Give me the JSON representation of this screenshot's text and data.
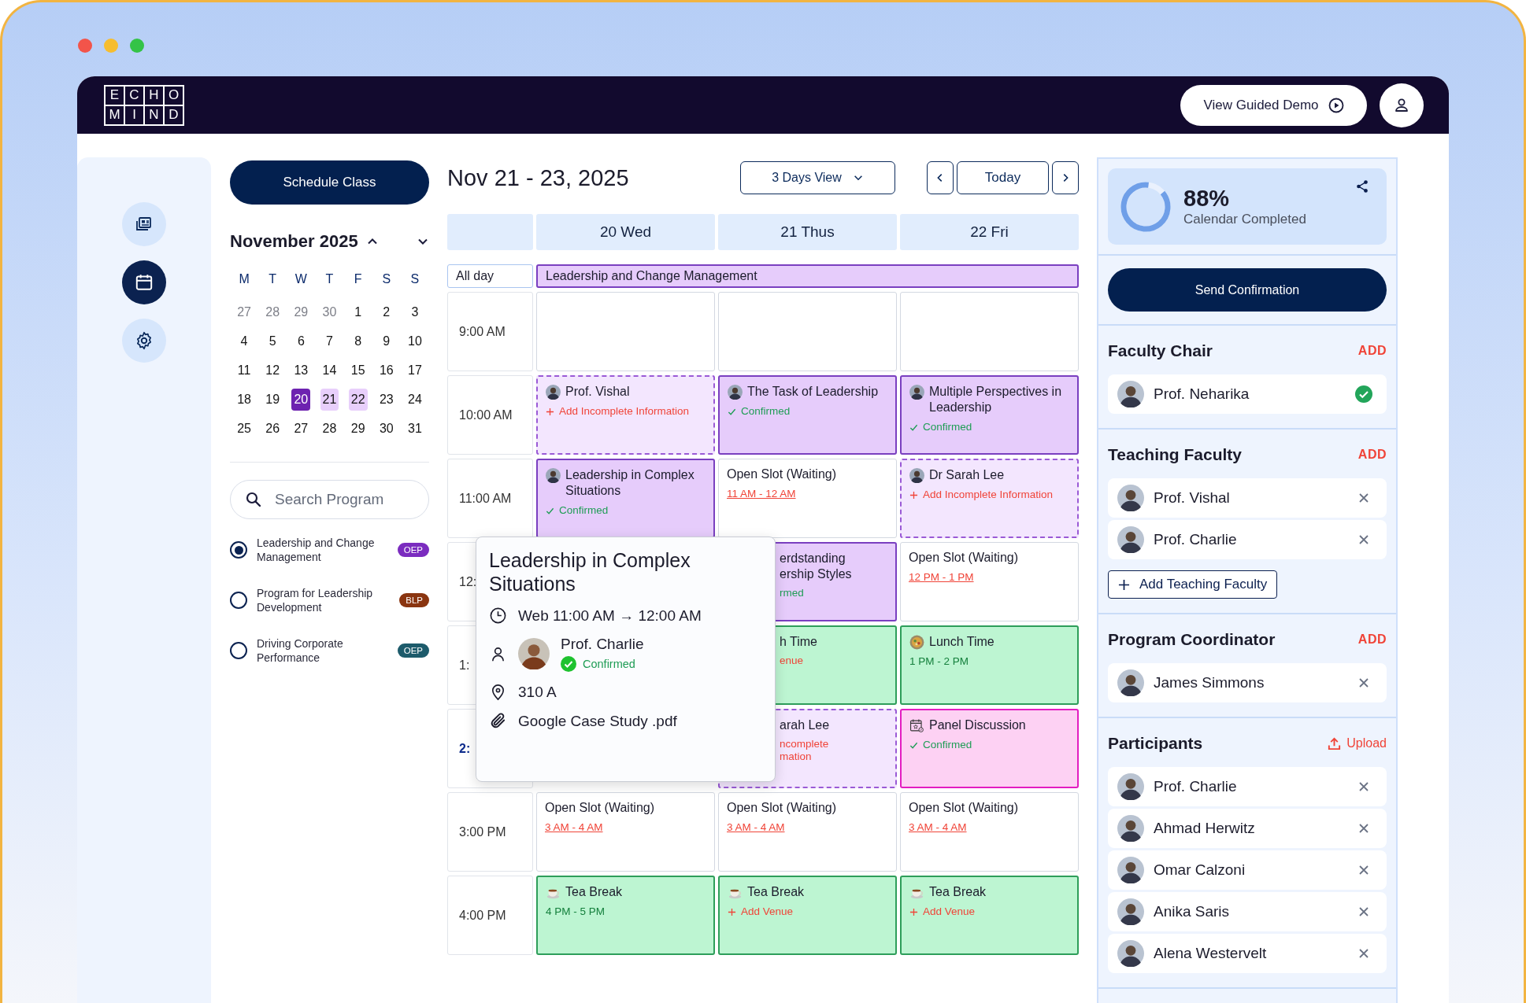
{
  "header": {
    "logo_rows": [
      [
        "E",
        "C",
        "H",
        "O"
      ],
      [
        "M",
        "I",
        "N",
        "D"
      ]
    ],
    "demo_button": "View Guided Demo"
  },
  "rail": [
    {
      "kind": "news",
      "selected": false
    },
    {
      "kind": "calendar",
      "selected": true
    },
    {
      "kind": "settings",
      "selected": false
    }
  ],
  "schedule_button": "Schedule Class",
  "mini_calendar": {
    "month": "November 2025",
    "weekdays": [
      "M",
      "T",
      "W",
      "T",
      "F",
      "S",
      "S"
    ],
    "weeks": [
      [
        {
          "label": "27",
          "muted": true,
          "selected": false,
          "range": false
        },
        {
          "label": "28",
          "muted": true,
          "selected": false,
          "range": false
        },
        {
          "label": "29",
          "muted": true,
          "selected": false,
          "range": false
        },
        {
          "label": "30",
          "muted": true,
          "selected": false,
          "range": false
        },
        {
          "label": "1",
          "muted": false,
          "selected": false,
          "range": false
        },
        {
          "label": "2",
          "muted": false,
          "selected": false,
          "range": false
        },
        {
          "label": "3",
          "muted": false,
          "selected": false,
          "range": false
        }
      ],
      [
        {
          "label": "4",
          "muted": false,
          "selected": false,
          "range": false
        },
        {
          "label": "5",
          "muted": false,
          "selected": false,
          "range": false
        },
        {
          "label": "6",
          "muted": false,
          "selected": false,
          "range": false
        },
        {
          "label": "7",
          "muted": false,
          "selected": false,
          "range": false
        },
        {
          "label": "8",
          "muted": false,
          "selected": false,
          "range": false
        },
        {
          "label": "9",
          "muted": false,
          "selected": false,
          "range": false
        },
        {
          "label": "10",
          "muted": false,
          "selected": false,
          "range": false
        }
      ],
      [
        {
          "label": "11",
          "muted": false,
          "selected": false,
          "range": false
        },
        {
          "label": "12",
          "muted": false,
          "selected": false,
          "range": false
        },
        {
          "label": "13",
          "muted": false,
          "selected": false,
          "range": false
        },
        {
          "label": "14",
          "muted": false,
          "selected": false,
          "range": false
        },
        {
          "label": "15",
          "muted": false,
          "selected": false,
          "range": false
        },
        {
          "label": "16",
          "muted": false,
          "selected": false,
          "range": false
        },
        {
          "label": "17",
          "muted": false,
          "selected": false,
          "range": false
        }
      ],
      [
        {
          "label": "18",
          "muted": false,
          "selected": false,
          "range": false
        },
        {
          "label": "19",
          "muted": false,
          "selected": false,
          "range": false
        },
        {
          "label": "20",
          "muted": false,
          "selected": true,
          "range": false
        },
        {
          "label": "21",
          "muted": false,
          "selected": false,
          "range": true
        },
        {
          "label": "22",
          "muted": false,
          "selected": false,
          "range": true
        },
        {
          "label": "23",
          "muted": false,
          "selected": false,
          "range": false
        },
        {
          "label": "24",
          "muted": false,
          "selected": false,
          "range": false
        }
      ],
      [
        {
          "label": "25",
          "muted": false,
          "selected": false,
          "range": false
        },
        {
          "label": "26",
          "muted": false,
          "selected": false,
          "range": false
        },
        {
          "label": "27",
          "muted": false,
          "selected": false,
          "range": false
        },
        {
          "label": "28",
          "muted": false,
          "selected": false,
          "range": false
        },
        {
          "label": "29",
          "muted": false,
          "selected": false,
          "range": false
        },
        {
          "label": "30",
          "muted": false,
          "selected": false,
          "range": false
        },
        {
          "label": "31",
          "muted": false,
          "selected": false,
          "range": false
        }
      ]
    ]
  },
  "search": {
    "placeholder": "Search Program"
  },
  "programs": [
    {
      "name": "Leadership and Change Management",
      "badge": "OEP",
      "color": "#7b2cbf",
      "selected": true
    },
    {
      "name": "Program for Leadership Development",
      "badge": "BLP",
      "color": "#8a3510",
      "selected": false
    },
    {
      "name": "Driving Corporate Performance",
      "badge": "OEP",
      "color": "#1d5b6b",
      "selected": false
    }
  ],
  "calendar": {
    "title": "Nov 21 - 23, 2025",
    "view": "3 Days View",
    "today": "Today",
    "days": [
      "20 Wed",
      "21 Thus",
      "22 Fri"
    ],
    "all_day_label": "All day",
    "all_day_event": "Leadership and Change Management",
    "rows": [
      {
        "time": "9:00 AM",
        "current": false,
        "cells": [
          {
            "kind": "blank"
          },
          {
            "kind": "blank"
          },
          {
            "kind": "blank"
          }
        ]
      },
      {
        "time": "10:00 AM",
        "current": false,
        "cells": [
          {
            "kind": "incomplete",
            "partial": false,
            "title": "Prof. Vishal",
            "detail": {
              "kind": "add",
              "text": "Add Incomplete Information"
            }
          },
          {
            "kind": "session",
            "partial": false,
            "title": "The Task of Leadership",
            "detail": {
              "kind": "confirmed",
              "text": "Confirmed"
            }
          },
          {
            "kind": "session",
            "partial": false,
            "title": "Multiple Perspectives in Leadership",
            "detail": {
              "kind": "confirmed",
              "text": "Confirmed"
            }
          }
        ]
      },
      {
        "time": "11:00 AM",
        "current": false,
        "cells": [
          {
            "kind": "session",
            "partial": false,
            "title": "Leadership in Complex Situations",
            "detail": {
              "kind": "confirmed",
              "text": "Confirmed"
            }
          },
          {
            "kind": "open",
            "partial": false,
            "title": "Open Slot (Waiting)",
            "detail": {
              "kind": "slot",
              "text": "11 AM - 12 AM"
            }
          },
          {
            "kind": "incomplete",
            "partial": false,
            "title": "Dr Sarah Lee",
            "detail": {
              "kind": "add",
              "text": "Add Incomplete Information"
            }
          }
        ]
      },
      {
        "time": "12:",
        "current": false,
        "cells": [
          {
            "kind": "hidden"
          },
          {
            "kind": "session",
            "partial": true,
            "title": "erdstanding\nership Styles",
            "detail": {
              "kind": "confirmed",
              "text": "rmed"
            }
          },
          {
            "kind": "open",
            "partial": false,
            "title": "Open Slot (Waiting)",
            "detail": {
              "kind": "slot",
              "text": "12 PM - 1 PM"
            }
          }
        ]
      },
      {
        "time": "1:",
        "current": false,
        "cells": [
          {
            "kind": "hidden"
          },
          {
            "kind": "lunch",
            "partial": true,
            "title": "h Time",
            "detail": {
              "kind": "add",
              "text": "enue"
            }
          },
          {
            "kind": "lunch",
            "partial": false,
            "title": "Lunch Time",
            "detail": {
              "kind": "time",
              "text": "1 PM - 2 PM"
            }
          }
        ]
      },
      {
        "time": "2:",
        "current": true,
        "cells": [
          {
            "kind": "hidden"
          },
          {
            "kind": "incomplete",
            "partial": true,
            "title": "arah Lee",
            "detail": {
              "kind": "add",
              "text": "ncomplete\nmation"
            }
          },
          {
            "kind": "panel",
            "partial": false,
            "title": "Panel Discussion",
            "detail": {
              "kind": "confirmed",
              "text": "Confirmed"
            }
          }
        ]
      },
      {
        "time": "3:00 PM",
        "current": false,
        "cells": [
          {
            "kind": "open",
            "partial": false,
            "title": "Open Slot (Waiting)",
            "detail": {
              "kind": "slot",
              "text": "3 AM - 4 AM"
            }
          },
          {
            "kind": "open",
            "partial": false,
            "title": "Open Slot (Waiting)",
            "detail": {
              "kind": "slot",
              "text": "3 AM - 4 AM"
            }
          },
          {
            "kind": "open",
            "partial": false,
            "title": "Open Slot (Waiting)",
            "detail": {
              "kind": "slot",
              "text": "3 AM - 4 AM"
            }
          }
        ]
      },
      {
        "time": "4:00 PM",
        "current": false,
        "cells": [
          {
            "kind": "tea",
            "partial": false,
            "title": "Tea Break",
            "detail": {
              "kind": "time",
              "text": "4 PM - 5 PM"
            }
          },
          {
            "kind": "tea",
            "partial": false,
            "title": "Tea Break",
            "detail": {
              "kind": "add",
              "text": "Add Venue"
            }
          },
          {
            "kind": "tea",
            "partial": false,
            "title": "Tea Break",
            "detail": {
              "kind": "add",
              "text": "Add Venue"
            }
          }
        ]
      }
    ]
  },
  "tooltip": {
    "title": "Leadership in Complex Situations",
    "time": "Web 11:00 AM → 12:00 AM",
    "person": "Prof. Charlie",
    "status": "Confirmed",
    "room": "310 A",
    "file": "Google Case Study .pdf"
  },
  "right": {
    "progress": {
      "percent": "88%",
      "label": "Calendar Completed",
      "level": 0.88
    },
    "send_button": "Send Confirmation",
    "sections": [
      {
        "title": "Faculty Chair",
        "action": "ADD",
        "kind": "add",
        "people": [
          {
            "name": "Prof. Neharika",
            "confirmed": true
          }
        ]
      },
      {
        "title": "Teaching Faculty",
        "action": "ADD",
        "kind": "add",
        "people": [
          {
            "name": "Prof. Vishal",
            "confirmed": false
          },
          {
            "name": "Prof. Charlie",
            "confirmed": false
          }
        ],
        "add_button": "Add Teaching Faculty"
      },
      {
        "title": "Program Coordinator",
        "action": "ADD",
        "kind": "add",
        "people": [
          {
            "name": "James Simmons",
            "confirmed": false
          }
        ]
      },
      {
        "title": "Participants",
        "action": "Upload",
        "kind": "upload",
        "people": [
          {
            "name": "Prof. Charlie",
            "confirmed": false
          },
          {
            "name": "Ahmad Herwitz",
            "confirmed": false
          },
          {
            "name": "Omar Calzoni",
            "confirmed": false
          },
          {
            "name": "Anika Saris",
            "confirmed": false
          },
          {
            "name": "Alena Westervelt",
            "confirmed": false
          }
        ]
      }
    ]
  }
}
